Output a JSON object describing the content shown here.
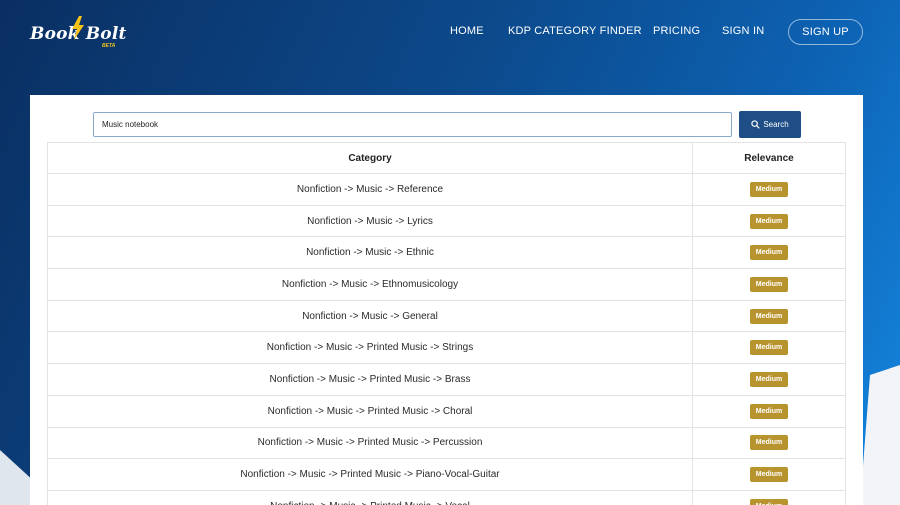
{
  "brand": {
    "name": "Book Bolt",
    "tag": "BETA",
    "accent": "#f3c319"
  },
  "nav": {
    "items": [
      {
        "label": "HOME"
      },
      {
        "label": "KDP CATEGORY FINDER"
      },
      {
        "label": "PRICING"
      },
      {
        "label": "SIGN IN"
      }
    ],
    "signup_label": "SIGN UP"
  },
  "search": {
    "value": "Music notebook",
    "button_label": "Search",
    "button_icon": "search-icon"
  },
  "table": {
    "headers": {
      "category": "Category",
      "relevance": "Relevance"
    },
    "rows": [
      {
        "category": "Nonfiction -> Music -> Reference",
        "relevance": "Medium"
      },
      {
        "category": "Nonfiction -> Music -> Lyrics",
        "relevance": "Medium"
      },
      {
        "category": "Nonfiction -> Music -> Ethnic",
        "relevance": "Medium"
      },
      {
        "category": "Nonfiction -> Music -> Ethnomusicology",
        "relevance": "Medium"
      },
      {
        "category": "Nonfiction -> Music -> General",
        "relevance": "Medium"
      },
      {
        "category": "Nonfiction -> Music -> Printed Music -> Strings",
        "relevance": "Medium"
      },
      {
        "category": "Nonfiction -> Music -> Printed Music -> Brass",
        "relevance": "Medium"
      },
      {
        "category": "Nonfiction -> Music -> Printed Music -> Choral",
        "relevance": "Medium"
      },
      {
        "category": "Nonfiction -> Music -> Printed Music -> Percussion",
        "relevance": "Medium"
      },
      {
        "category": "Nonfiction -> Music -> Printed Music -> Piano-Vocal-Guitar",
        "relevance": "Medium"
      },
      {
        "category": "Nonfiction -> Music -> Printed Music -> Vocal",
        "relevance": "Medium"
      }
    ]
  },
  "colors": {
    "badge": "#b8942e",
    "button": "#1f4e86",
    "header_bg": "#0c4a8c"
  }
}
